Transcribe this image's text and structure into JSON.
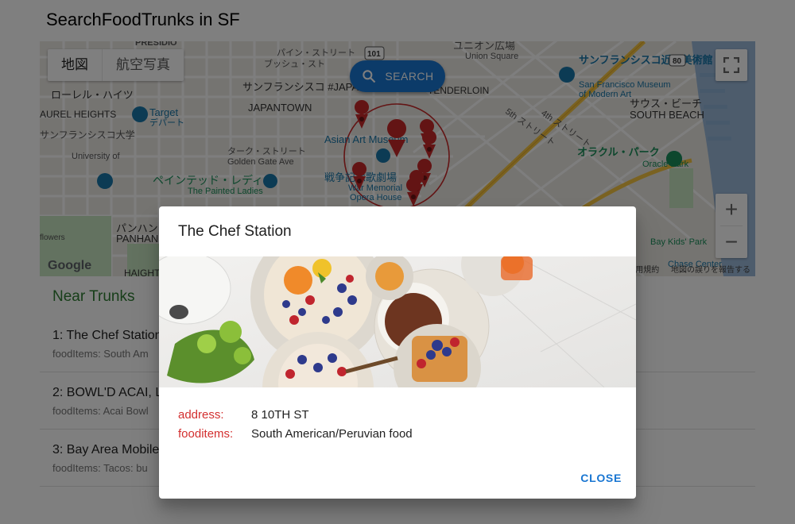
{
  "app": {
    "title": "SearchFoodTrunks in SF"
  },
  "map": {
    "map_type_tabs": [
      "地図",
      "航空写真"
    ],
    "active_tab": "地図",
    "search_label": "SEARCH",
    "zoom_in": "+",
    "zoom_out": "−",
    "google_logo": "Google",
    "footer_links": [
      "利用規約",
      "地図の誤りを報告する"
    ],
    "labels": {
      "presidio": "PRESIDIO",
      "union_square": "ユニオン広場",
      "union_square_en": "Union Square",
      "sfmoma": "サンフランシスコ近代美術館",
      "sfmoma_en1": "San Francisco Museum",
      "sfmoma_en2": "of Modern Art",
      "laurel_ja": "ローレル・ハイツ",
      "laurel_en": "AUREL HEIGHTS",
      "target": "Target",
      "target_ja": "デパート",
      "usf_ja": "サンフランシスコ大学",
      "usf_en": "University of",
      "japantown_ja": "サンフランシスコ #JAPANTOWN",
      "japantown_en": "JAPANTOWN",
      "tenderloin": "TENDERLOIN",
      "asian_art": "Asian Art Museum",
      "south_beach_ja": "サウス・ビーチ",
      "south_beach_en": "SOUTH BEACH",
      "oracle_ja": "オラクル・パーク",
      "oracle_en": "Oracle Park",
      "painted_ja": "ペインテッド・レディ",
      "painted_en": "The Painted Ladies",
      "war_memorial": "War Memorial",
      "opera_house": "Opera House",
      "war_memorial_ja": "戦争記念歌劇場",
      "panhandle_ja": "パンハンドル",
      "panhandle_en": "PANHANDLE",
      "haight": "HAIGHT",
      "turk": "ターク・ストリート",
      "golden_gate": "Golden Gate Ave",
      "fourth": "4th ストリート",
      "fifth": "5th ストリート",
      "bay_kids": "Bay Kids' Park",
      "chase": "Chase Center",
      "bush": "ブッシュ・スト",
      "pine": "パイン・ストリート",
      "route": "101",
      "route80": "80",
      "flowers": "flowers"
    }
  },
  "near_trunks": {
    "title": "Near Trunks",
    "items": [
      {
        "name": "1: The Chef Station",
        "sub": "foodItems: South Am"
      },
      {
        "name": "2: BOWL'D ACAI, LL",
        "sub": "foodItems: Acai Bowl"
      },
      {
        "name": "3: Bay Area Mobile",
        "sub": "foodItems: Tacos: bu"
      }
    ]
  },
  "dialog": {
    "title": "The Chef Station",
    "address_label": "address:",
    "address_value": "8 10TH ST",
    "fooditems_label": "fooditems:",
    "fooditems_value": "South American/Peruvian food",
    "close_label": "CLOSE"
  },
  "colors": {
    "accent": "#1976d2",
    "list_title": "#2e7d32",
    "field_label": "#d32f2f",
    "marker": "#c62828"
  }
}
